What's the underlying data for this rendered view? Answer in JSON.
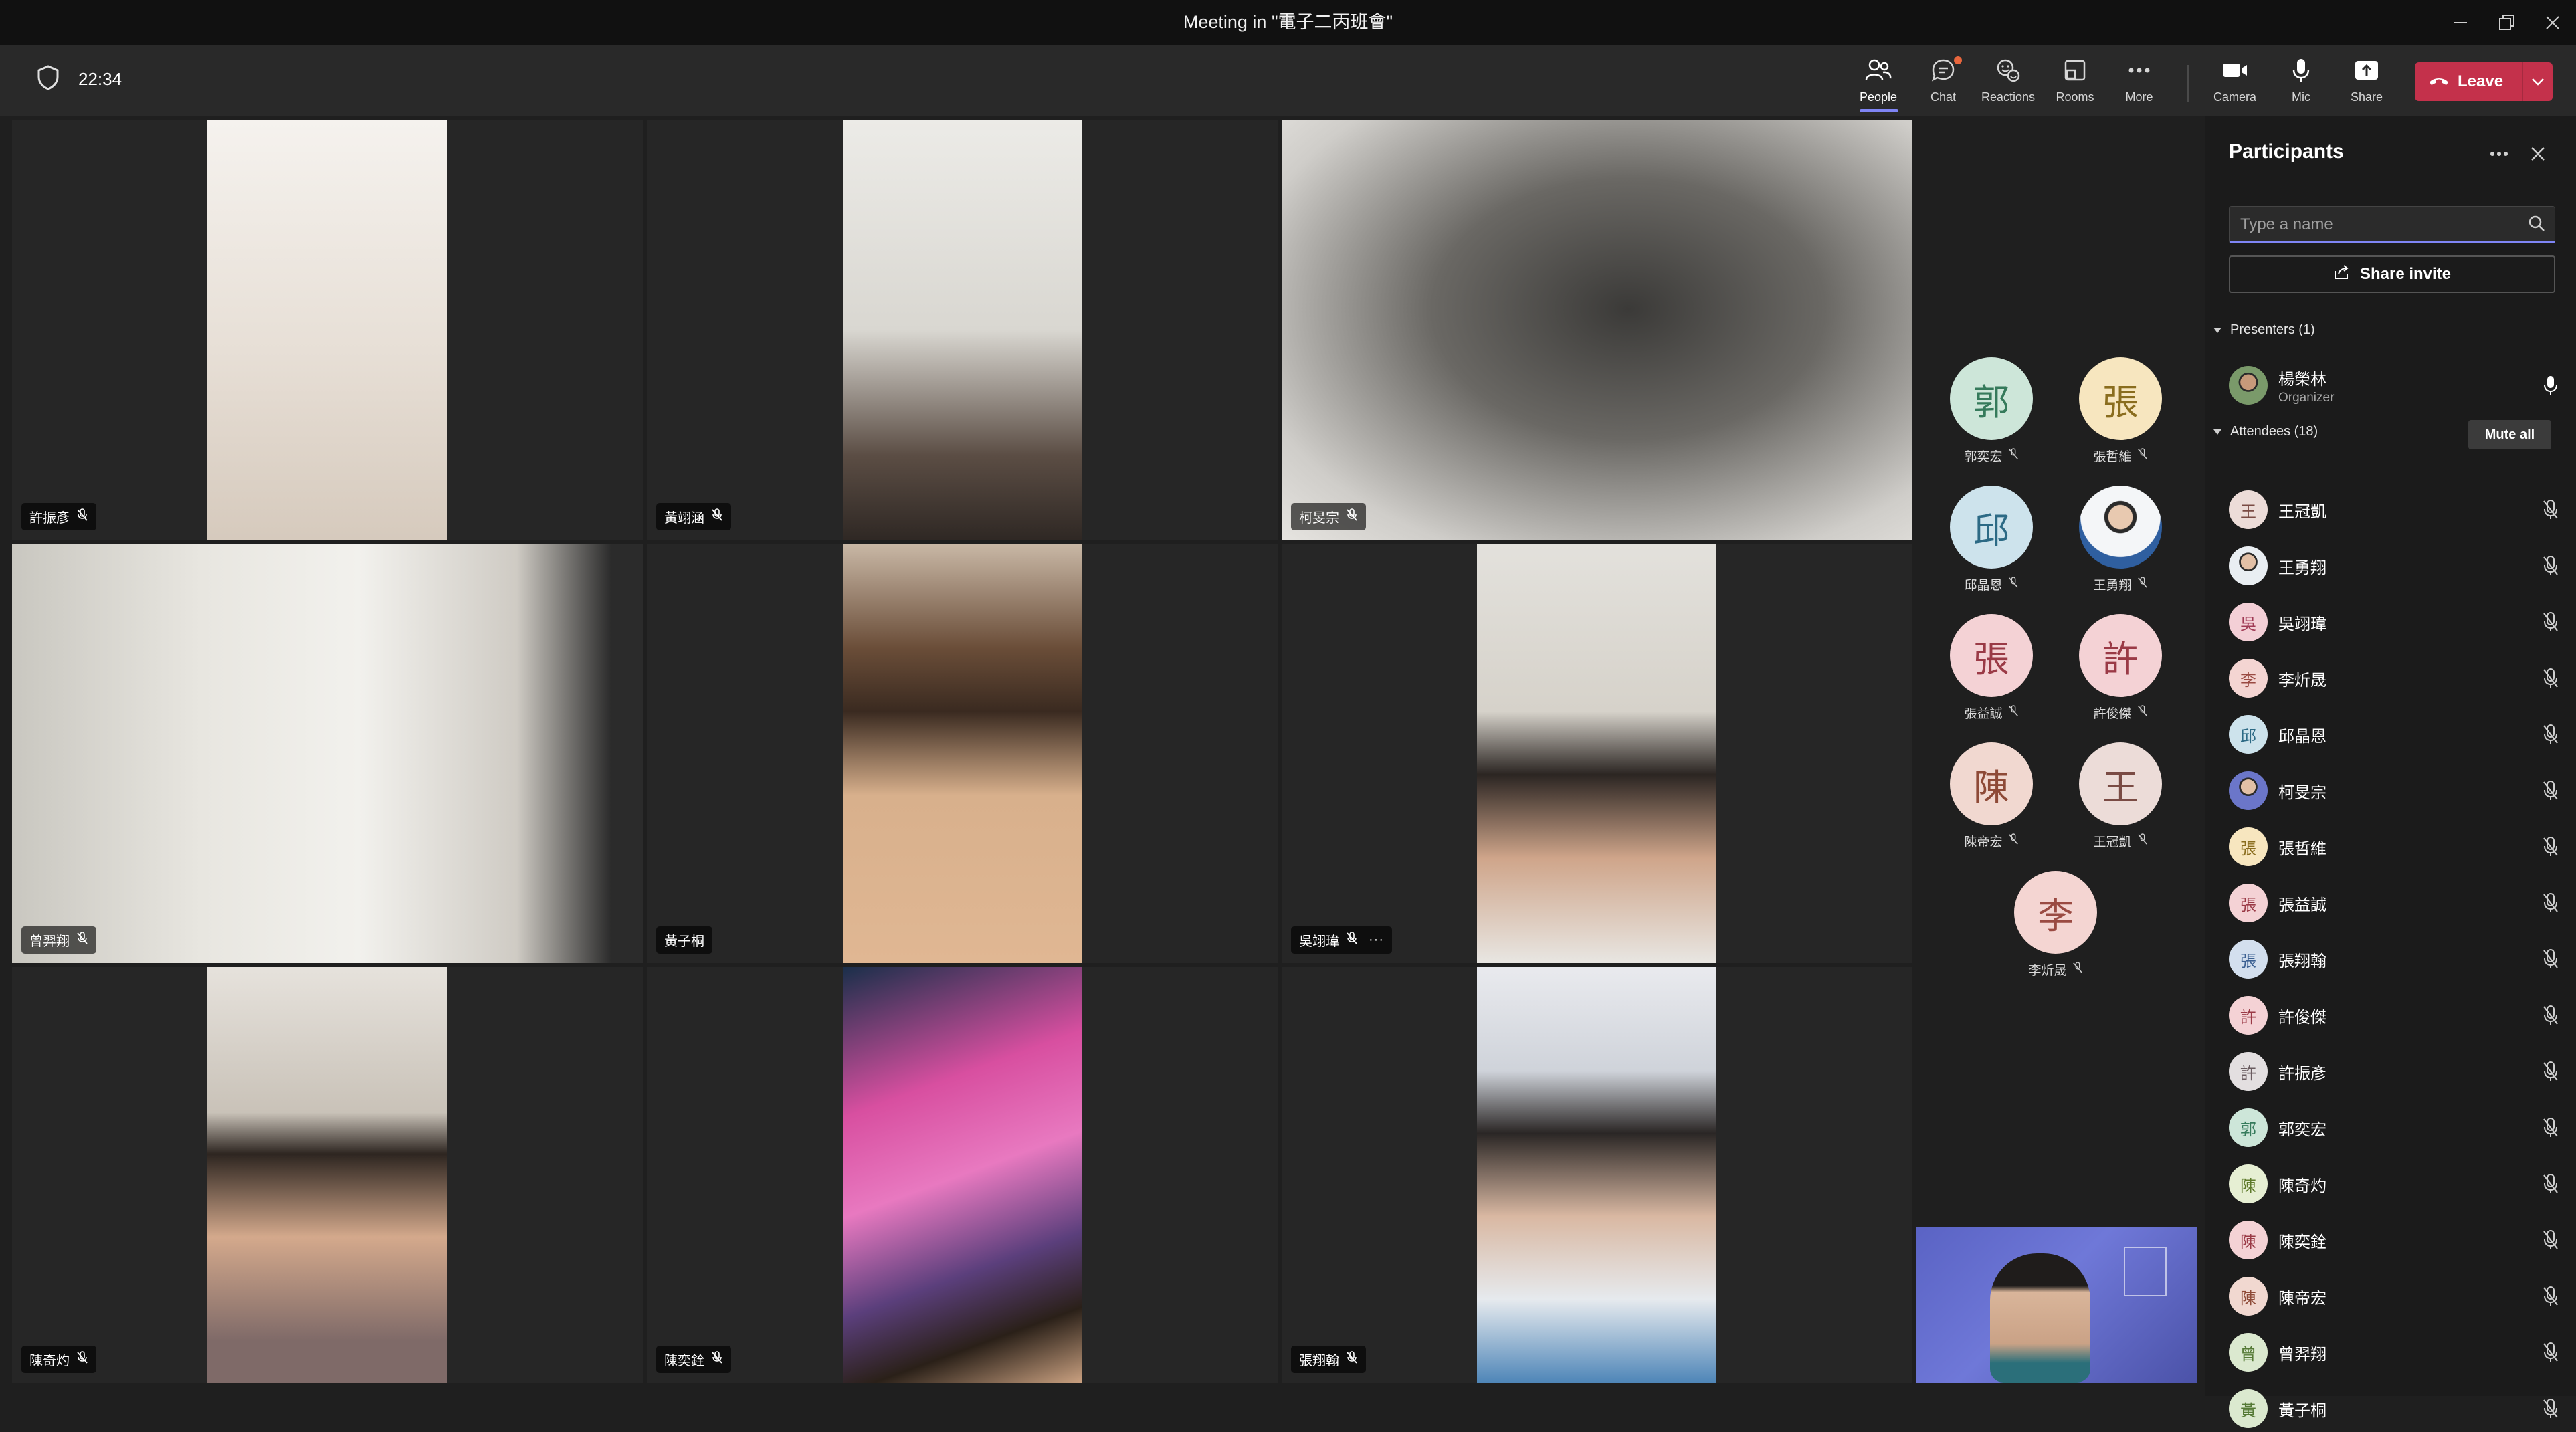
{
  "window": {
    "title": "Meeting in \"電子二丙班會\""
  },
  "toolbar": {
    "timer": "22:34",
    "buttons": {
      "people": "People",
      "chat": "Chat",
      "reactions": "Reactions",
      "rooms": "Rooms",
      "more": "More",
      "camera": "Camera",
      "mic": "Mic",
      "share": "Share"
    },
    "leave": "Leave",
    "accent": "#7f85f5",
    "leave_color": "#c4314b"
  },
  "tiles": [
    {
      "name": "許振彥"
    },
    {
      "name": "黃翊涵"
    },
    {
      "name": "柯旻宗"
    },
    {
      "name": "曾羿翔"
    },
    {
      "name": "黃子桐"
    },
    {
      "name": "吳翊瑋",
      "more": "···"
    },
    {
      "name": "陳奇灼"
    },
    {
      "name": "陳奕銓"
    },
    {
      "name": "張翔翰"
    }
  ],
  "avatars": [
    {
      "char": "郭",
      "name": "郭奕宏",
      "bg": "#cde6d9",
      "fg": "#357a5b"
    },
    {
      "char": "張",
      "name": "張哲維",
      "bg": "#f7e6bf",
      "fg": "#8a6d1e"
    },
    {
      "char": "邱",
      "name": "邱晶恩",
      "bg": "#cde3ec",
      "fg": "#2c6a85"
    },
    {
      "char": "",
      "name": "王勇翔",
      "bg": "#e9eef2",
      "fg": "#2f5fa0",
      "photo": true
    },
    {
      "char": "張",
      "name": "張益誠",
      "bg": "#f4d2d5",
      "fg": "#9a3a46"
    },
    {
      "char": "許",
      "name": "許俊傑",
      "bg": "#f4d2d5",
      "fg": "#9a3a46"
    },
    {
      "char": "陳",
      "name": "陳帝宏",
      "bg": "#f1d8d0",
      "fg": "#8e4a37"
    },
    {
      "char": "王",
      "name": "王冠凱",
      "bg": "#ecdcd8",
      "fg": "#7a4b44"
    },
    {
      "char": "李",
      "name": "李炘晟",
      "bg": "#f4d5d2",
      "fg": "#9a4a42"
    }
  ],
  "panel": {
    "title": "Participants",
    "search_placeholder": "Type a name",
    "share_invite": "Share invite",
    "presenters_label": "Presenters (1)",
    "attendees_label": "Attendees (18)",
    "mute_all": "Mute all",
    "organizer": {
      "name": "楊榮林",
      "role": "Organizer"
    },
    "attendees": [
      {
        "char": "王",
        "name": "王冠凱",
        "bg": "#ecdcd8",
        "fg": "#7a4b44"
      },
      {
        "char": "",
        "name": "王勇翔",
        "bg": "#e9eef2",
        "fg": "#2f5fa0",
        "photo": true
      },
      {
        "char": "吳",
        "name": "吳翊瑋",
        "bg": "#f3cfd6",
        "fg": "#a03a55"
      },
      {
        "char": "李",
        "name": "李炘晟",
        "bg": "#f4d5d2",
        "fg": "#9a4a42"
      },
      {
        "char": "邱",
        "name": "邱晶恩",
        "bg": "#cde3ec",
        "fg": "#2c6a85"
      },
      {
        "char": "",
        "name": "柯旻宗",
        "bg": "#6b76c9",
        "fg": "#ffffff",
        "photo": true
      },
      {
        "char": "張",
        "name": "張哲維",
        "bg": "#f7e6bf",
        "fg": "#8a6d1e"
      },
      {
        "char": "張",
        "name": "張益誠",
        "bg": "#f4d2d5",
        "fg": "#9a3a46"
      },
      {
        "char": "張",
        "name": "張翔翰",
        "bg": "#d3dfee",
        "fg": "#3a5f91"
      },
      {
        "char": "許",
        "name": "許俊傑",
        "bg": "#f4d2d5",
        "fg": "#9a3a46"
      },
      {
        "char": "許",
        "name": "許振彥",
        "bg": "#e3dfe0",
        "fg": "#6a5c60"
      },
      {
        "char": "郭",
        "name": "郭奕宏",
        "bg": "#cde6d9",
        "fg": "#357a5b"
      },
      {
        "char": "陳",
        "name": "陳奇灼",
        "bg": "#e6efd3",
        "fg": "#5d7a2a"
      },
      {
        "char": "陳",
        "name": "陳奕銓",
        "bg": "#f4d2d5",
        "fg": "#9a3a46"
      },
      {
        "char": "陳",
        "name": "陳帝宏",
        "bg": "#f1d8d0",
        "fg": "#8e4a37"
      },
      {
        "char": "曾",
        "name": "曾羿翔",
        "bg": "#dbe9cf",
        "fg": "#557a36"
      },
      {
        "char": "黃",
        "name": "黃子桐",
        "bg": "#dbe9cf",
        "fg": "#557a36"
      }
    ]
  }
}
